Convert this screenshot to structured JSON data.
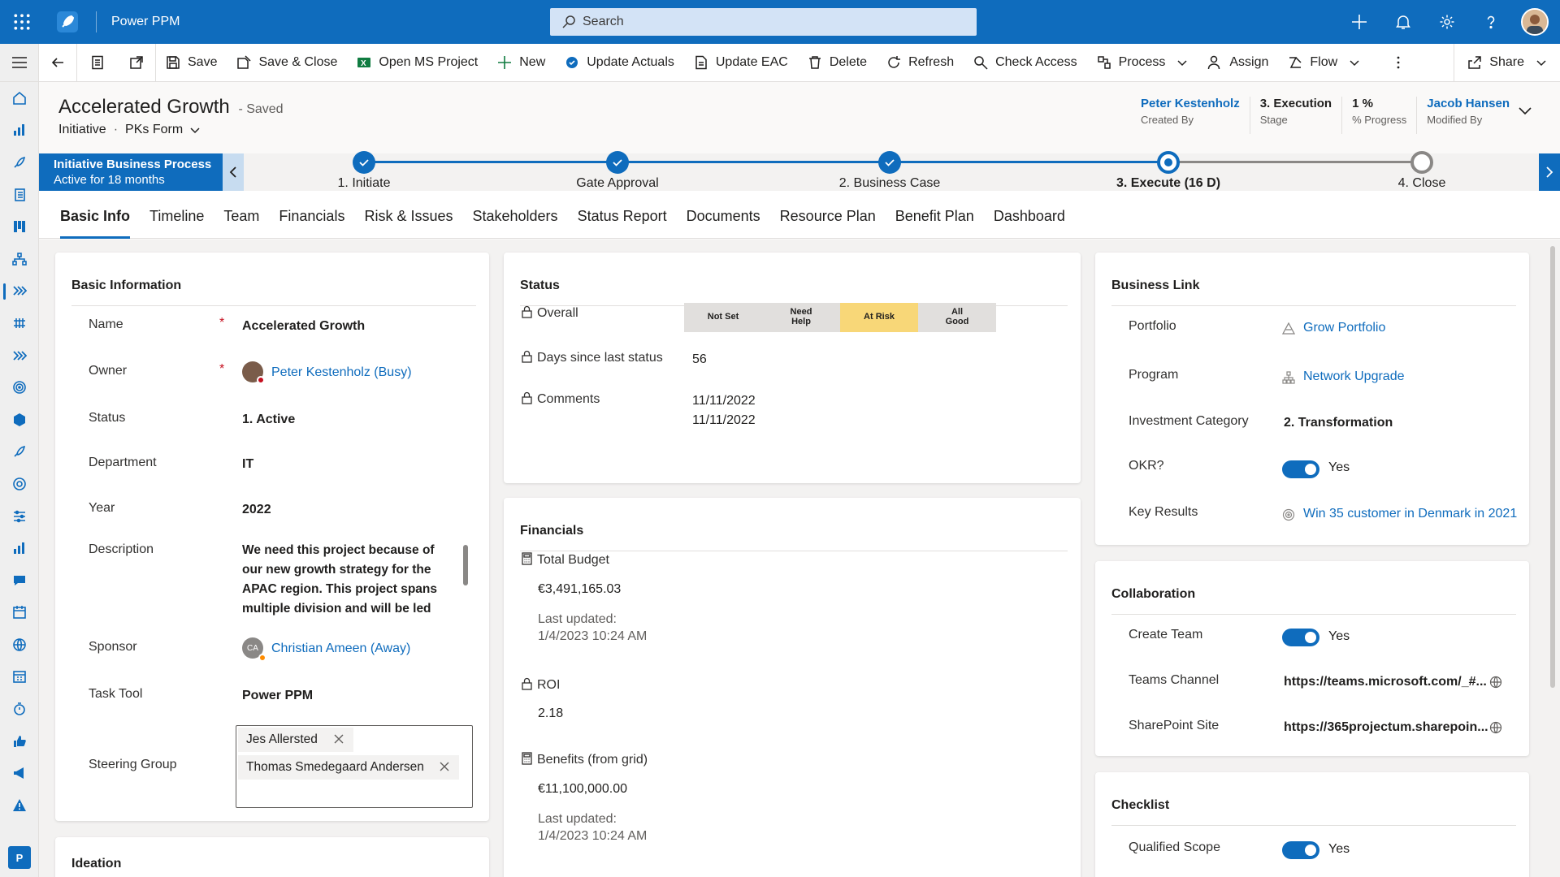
{
  "app": {
    "name": "Power PPM",
    "search_placeholder": "Search"
  },
  "commands": {
    "save": "Save",
    "save_close": "Save & Close",
    "open_ms_project": "Open MS Project",
    "new": "New",
    "update_actuals": "Update Actuals",
    "update_eac": "Update EAC",
    "delete": "Delete",
    "refresh": "Refresh",
    "check_access": "Check Access",
    "process": "Process",
    "assign": "Assign",
    "flow": "Flow",
    "share": "Share"
  },
  "record": {
    "title": "Accelerated Growth",
    "saved": "- Saved",
    "entity": "Initiative",
    "form": "PKs Form",
    "header_fields": [
      {
        "value": "Peter Kestenholz",
        "label": "Created By",
        "link": true
      },
      {
        "value": "3. Execution",
        "label": "Stage",
        "link": false
      },
      {
        "value": "1 %",
        "label": "% Progress",
        "link": false
      },
      {
        "value": "Jacob Hansen",
        "label": "Modified By",
        "link": true
      }
    ]
  },
  "bpf": {
    "name": "Initiative Business Process",
    "duration": "Active for 18 months",
    "stages": [
      {
        "label": "1. Initiate",
        "state": "done"
      },
      {
        "label": "Gate Approval",
        "state": "done"
      },
      {
        "label": "2. Business Case",
        "state": "done"
      },
      {
        "label": "3. Execute  (16 D)",
        "state": "current"
      },
      {
        "label": "4. Close",
        "state": "todo"
      }
    ]
  },
  "tabs": [
    "Basic Info",
    "Timeline",
    "Team",
    "Financials",
    "Risk & Issues",
    "Stakeholders",
    "Status Report",
    "Documents",
    "Resource Plan",
    "Benefit Plan",
    "Dashboard"
  ],
  "basic_info": {
    "title": "Basic Information",
    "name_label": "Name",
    "name_value": "Accelerated Growth",
    "owner_label": "Owner",
    "owner_value": "Peter Kestenholz (Busy)",
    "status_label": "Status",
    "status_value": "1. Active",
    "department_label": "Department",
    "department_value": "IT",
    "year_label": "Year",
    "year_value": "2022",
    "description_label": "Description",
    "description_value": "We need this project because of our new growth strategy for the APAC region. This project spans multiple division and will be led as",
    "sponsor_label": "Sponsor",
    "sponsor_value": "Christian Ameen (Away)",
    "sponsor_initials": "CA",
    "task_tool_label": "Task Tool",
    "task_tool_value": "Power PPM",
    "steering_label": "Steering Group",
    "steering_members": [
      "Jes Allersted",
      "Thomas Smedegaard Andersen"
    ]
  },
  "ideation": {
    "title": "Ideation"
  },
  "status": {
    "title": "Status",
    "overall_label": "Overall",
    "overall_options": [
      "Not Set",
      "Need Help",
      "At Risk",
      "All Good"
    ],
    "overall_selected": "At Risk",
    "days_label": "Days since last status",
    "days_value": "56",
    "comments_label": "Comments",
    "comments_line1": "11/11/2022",
    "comments_line2": "11/11/2022"
  },
  "financials": {
    "title": "Financials",
    "total_budget_label": "Total Budget",
    "total_budget_value": "€3,491,165.03",
    "total_budget_updated_label": "Last updated:",
    "total_budget_updated": "1/4/2023 10:24 AM",
    "roi_label": "ROI",
    "roi_value": "2.18",
    "benefits_label": "Benefits (from grid)",
    "benefits_value": "€11,100,000.00",
    "benefits_updated_label": "Last updated:",
    "benefits_updated": "1/4/2023 10:24 AM"
  },
  "business_link": {
    "title": "Business Link",
    "portfolio_label": "Portfolio",
    "portfolio_value": "Grow Portfolio",
    "program_label": "Program",
    "program_value": "Network Upgrade",
    "investment_label": "Investment Category",
    "investment_value": "2. Transformation",
    "okr_label": "OKR?",
    "okr_value": "Yes",
    "key_results_label": "Key Results",
    "key_results_value": "Win 35 customer in Denmark in 2021"
  },
  "collaboration": {
    "title": "Collaboration",
    "create_team_label": "Create Team",
    "create_team_value": "Yes",
    "teams_channel_label": "Teams Channel",
    "teams_channel_value": "https://teams.microsoft.com/_#...",
    "sharepoint_label": "SharePoint Site",
    "sharepoint_value": "https://365projectum.sharepoin..."
  },
  "checklist": {
    "title": "Checklist",
    "qualified_scope_label": "Qualified Scope",
    "qualified_scope_value": "Yes"
  },
  "colors": {
    "brand": "#0f6cbd",
    "at_risk": "#f8d778",
    "required": "#c50f1f"
  }
}
